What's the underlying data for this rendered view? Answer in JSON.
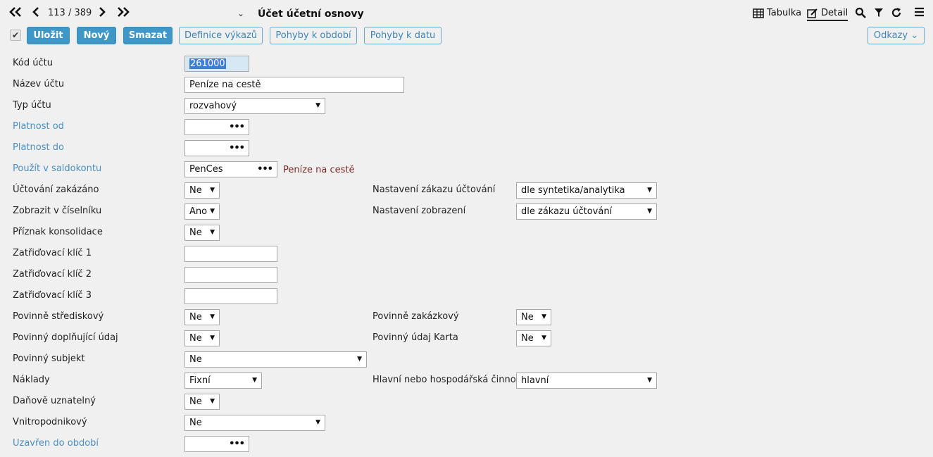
{
  "nav": {
    "first_icon": "double-chevron-left-icon",
    "prev_icon": "chevron-left-icon",
    "pager": "113 / 389",
    "next_icon": "chevron-right-icon",
    "last_icon": "double-chevron-right-icon",
    "title_caret": "⌄",
    "title": "Účet účetní osnovy",
    "view_table": "Tabulka",
    "view_detail": "Detail"
  },
  "toolbar": {
    "checkbox": "✔",
    "save": "Uložit",
    "new": "Nový",
    "delete": "Smazat",
    "report_def": "Definice výkazů",
    "movements_period": "Pohyby k období",
    "movements_date": "Pohyby k datu",
    "links": "Odkazy ⌄"
  },
  "form": {
    "account_code": {
      "label": "Kód účtu",
      "value": "261000"
    },
    "account_name": {
      "label": "Název účtu",
      "value": "Peníze na cestě"
    },
    "account_type": {
      "label": "Typ účtu",
      "value": "rozvahový"
    },
    "valid_from": {
      "label": "Platnost od",
      "value": ""
    },
    "valid_to": {
      "label": "Platnost do",
      "value": ""
    },
    "saldo": {
      "label": "Použít v saldokontu",
      "value": "PenCes",
      "link": "Peníze na cestě"
    },
    "posting_forbidden": {
      "label": "Účtování zakázáno",
      "value": "Ne"
    },
    "posting_forbidden_setting": {
      "label": "Nastavení zákazu účtování",
      "value": "dle syntetika/analytika"
    },
    "show_in_list": {
      "label": "Zobrazit v číselníku",
      "value": "Ano"
    },
    "display_setting": {
      "label": "Nastavení zobrazení",
      "value": "dle zákazu účtování"
    },
    "consolidation": {
      "label": "Příznak konsolidace",
      "value": "Ne"
    },
    "key1": {
      "label": "Zatřiďovací klíč 1",
      "value": ""
    },
    "key2": {
      "label": "Zatřiďovací klíč 2",
      "value": ""
    },
    "key3": {
      "label": "Zatřiďovací klíč 3",
      "value": ""
    },
    "mandatory_center": {
      "label": "Povinně střediskový",
      "value": "Ne"
    },
    "mandatory_order": {
      "label": "Povinně zakázkový",
      "value": "Ne"
    },
    "mandatory_extra": {
      "label": "Povinný doplňující údaj",
      "value": "Ne"
    },
    "mandatory_card": {
      "label": "Povinný údaj Karta",
      "value": "Ne"
    },
    "mandatory_subject": {
      "label": "Povinný subjekt",
      "value": "Ne"
    },
    "costs": {
      "label": "Náklady",
      "value": "Fixní"
    },
    "activity": {
      "label": "Hlavní nebo hospodářská činnost",
      "value": "hlavní"
    },
    "tax_deductible": {
      "label": "Daňově uznatelný",
      "value": "Ne"
    },
    "intracompany": {
      "label": "Vnitropodnikový",
      "value": "Ne"
    },
    "closed_until": {
      "label": "Uzavřen do období",
      "value": ""
    }
  }
}
